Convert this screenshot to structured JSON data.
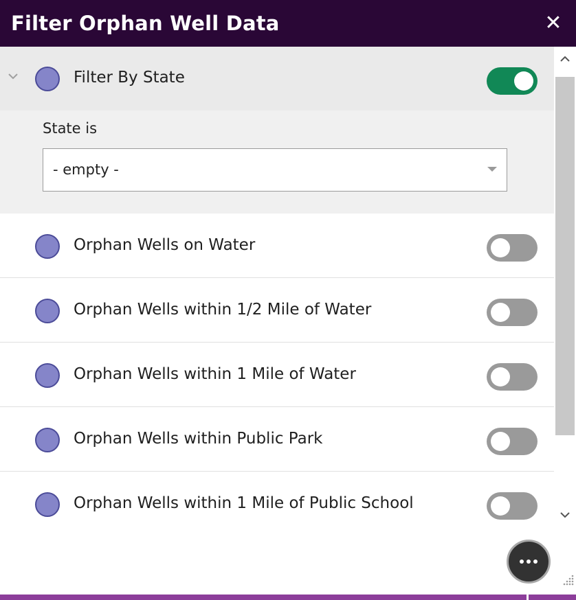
{
  "header": {
    "title": "Filter Orphan Well Data",
    "close_glyph": "✕"
  },
  "filters": [
    {
      "label": "Filter By State",
      "enabled": true,
      "expanded": true,
      "expression": {
        "label": "State is",
        "value": "- empty -"
      }
    },
    {
      "label": "Orphan Wells on Water",
      "enabled": false
    },
    {
      "label": "Orphan Wells within 1/2 Mile of Water",
      "enabled": false
    },
    {
      "label": "Orphan Wells within 1 Mile of Water",
      "enabled": false
    },
    {
      "label": "Orphan Wells within Public Park",
      "enabled": false
    },
    {
      "label": "Orphan Wells within 1 Mile of Public School",
      "enabled": false
    }
  ],
  "icons": {
    "dot_color": "#8585c9",
    "dot_border": "#4b4b98",
    "more_button": "more-horizontal-icon",
    "chevron": "chevron-down-icon"
  },
  "colors": {
    "header_bg": "#2a0736",
    "toggle_on": "#118856",
    "toggle_off": "#9a9a9a",
    "bottom_bar": "#8c3e9a"
  }
}
